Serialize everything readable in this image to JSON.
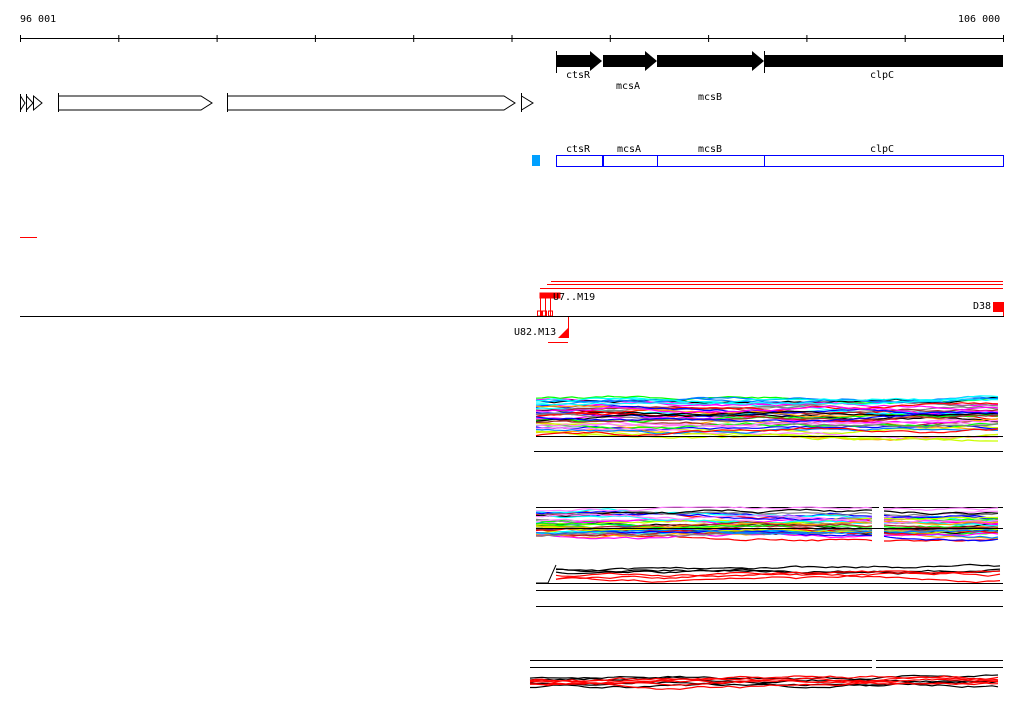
{
  "ruler": {
    "start_label": "96 001",
    "end_label": "106 000",
    "start": 96001,
    "end": 106000
  },
  "genes_annotated": [
    {
      "name": "ctsR",
      "start": 101430,
      "end": 101890
    },
    {
      "name": "mcsA",
      "start": 101900,
      "end": 102440
    },
    {
      "name": "mcsB",
      "start": 102440,
      "end": 103520
    },
    {
      "name": "clpC",
      "start": 103520,
      "end": 106000
    }
  ],
  "gene_boxes": [
    "ctsR",
    "mcsA",
    "mcsB",
    "clpC"
  ],
  "markers": {
    "right_label": "D38",
    "below_label": "U82.M13",
    "overlap_label": "U7..M19"
  },
  "colors": {
    "gene_box": "#0000ff",
    "marker": "#ff0000",
    "cyan_box": "#00a0ff"
  }
}
